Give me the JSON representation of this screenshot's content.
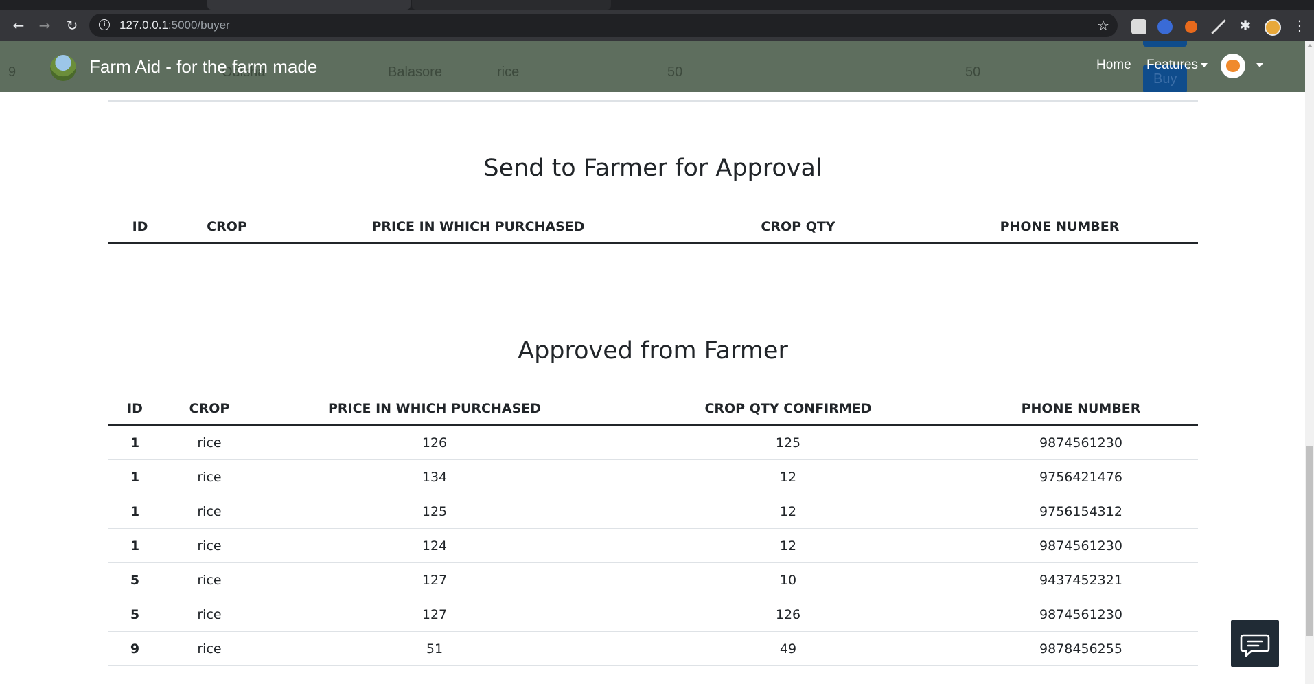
{
  "browser": {
    "url_host": "127.0.0.1",
    "url_path": ":5000/buyer"
  },
  "navbar": {
    "brand": "Farm Aid - for the farm made",
    "home": "Home",
    "features": "Features",
    "behind_row": {
      "id": "9",
      "state": "Odisha",
      "district": "Balasore",
      "crop": "rice",
      "price": "50",
      "qty": "50",
      "buy": "Buy"
    }
  },
  "pending": {
    "title": "Send to Farmer for Approval",
    "headers": [
      "ID",
      "CROP",
      "PRICE IN WHICH PURCHASED",
      "CROP QTY",
      "PHONE NUMBER"
    ]
  },
  "approved": {
    "title": "Approved from Farmer",
    "headers": [
      "ID",
      "CROP",
      "PRICE IN WHICH PURCHASED",
      "CROP QTY CONFIRMED",
      "PHONE NUMBER"
    ],
    "rows": [
      [
        "1",
        "rice",
        "126",
        "125",
        "9874561230"
      ],
      [
        "1",
        "rice",
        "134",
        "12",
        "9756421476"
      ],
      [
        "1",
        "rice",
        "125",
        "12",
        "9756154312"
      ],
      [
        "1",
        "rice",
        "124",
        "12",
        "9874561230"
      ],
      [
        "5",
        "rice",
        "127",
        "10",
        "9437452321"
      ],
      [
        "5",
        "rice",
        "127",
        "126",
        "9874561230"
      ],
      [
        "9",
        "rice",
        "51",
        "49",
        "9878456255"
      ]
    ]
  },
  "colors": {
    "navbar": "#5e6e5e",
    "buy_button": "#0f4c8c",
    "chat_widget": "#202b35"
  }
}
